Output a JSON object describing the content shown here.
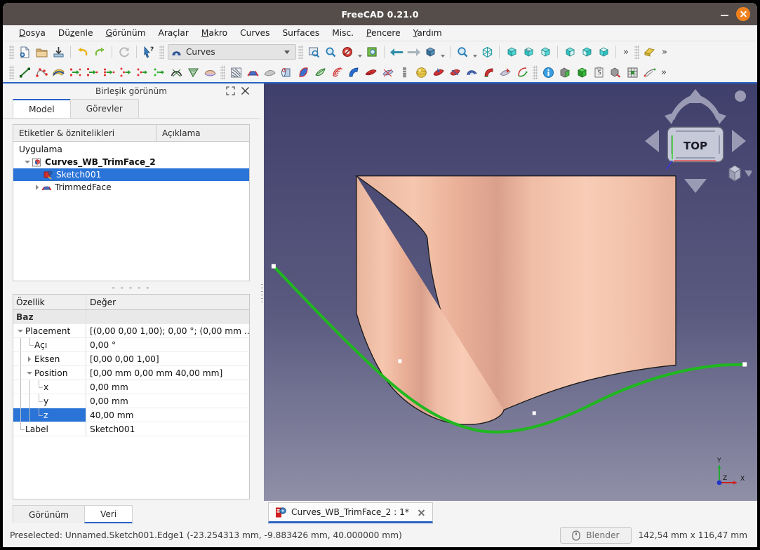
{
  "window": {
    "title": "FreeCAD 0.21.0",
    "minimize_label": "minimize-icon",
    "close_label": "close-icon",
    "accent_color": "#2a63c4",
    "close_button_color": "#f0821e",
    "titlebar_color": "#544d4a"
  },
  "menubar": {
    "items": [
      {
        "label": "Dosya",
        "accel": "D"
      },
      {
        "label": "Düzenle",
        "accel": "z"
      },
      {
        "label": "Görünüm",
        "accel": "G"
      },
      {
        "label": "Araçlar",
        "accel": ""
      },
      {
        "label": "Makro",
        "accel": "M"
      },
      {
        "label": "Curves",
        "accel": ""
      },
      {
        "label": "Surfaces",
        "accel": ""
      },
      {
        "label": "Misc.",
        "accel": ""
      },
      {
        "label": "Pencere",
        "accel": "P"
      },
      {
        "label": "Yardım",
        "accel": "Y"
      }
    ]
  },
  "toolbar": {
    "workbench_selected": "Curves",
    "overflow_label": "»",
    "row1_icons": [
      "new-document-icon",
      "open-document-icon",
      "save-document-icon",
      "undo-icon",
      "redo-icon",
      "refresh-icon",
      "whats-this-icon"
    ],
    "row1_view_icons": [
      "fit-all-icon",
      "fit-selection-icon",
      "draw-style-icon",
      "box-selection-icon",
      "back-arrow-icon",
      "forward-arrow-icon",
      "axonometric-view-icon",
      "zoom-icon",
      "isometric-view-icon",
      "front-view-icon",
      "top-view-icon",
      "right-view-icon",
      "rear-view-icon",
      "bottom-view-icon",
      "left-view-icon"
    ],
    "row2_icons": [
      "line-icon",
      "bezier-curve-icon",
      "gordon-surface-icon",
      "join-curve-icon",
      "discretize-icon",
      "approximate-icon",
      "interpolate-icon",
      "parametric-blend-icon",
      "curve-extend-icon",
      "curve-on-surface-icon",
      "sketch-on-surface-icon",
      "surface-patch-icon",
      "isocurve-icon",
      "blend-surface-icon",
      "flatten-face-icon",
      "pipeshell-icon",
      "sweep2rails-icon",
      "profile-support-icon",
      "segment-surface-icon",
      "ruled-surface-icon",
      "trim-face-icon",
      "surface-knots-icon",
      "compression-spring-icon",
      "sphere-icon",
      "zebra-stripes-icon",
      "solid-from-shell-icon",
      "face-map-icon",
      "pipe-icon",
      "paste-object-icon",
      "mixed-curve-icon",
      "info-icon",
      "extract-shape-icon",
      "solid-box-icon",
      "clipboard-icon",
      "shape-info-icon",
      "grid-icon",
      "nurbs-icon"
    ]
  },
  "left_panel": {
    "header_title": "Birleşik görünüm",
    "float_icon": "restore-icon",
    "close_icon": "close-icon",
    "tabs": [
      {
        "label": "Model",
        "active": true
      },
      {
        "label": "Görevler",
        "active": false
      }
    ],
    "tree": {
      "columns": [
        "Etiketler & öznitelikleri",
        "Açıklama"
      ],
      "root_label": "Uygulama",
      "nodes": [
        {
          "label": "Curves_WB_TrimFace_2",
          "icon": "document-icon",
          "depth": 1,
          "expander": "down",
          "bold": true,
          "selected": false
        },
        {
          "label": "Sketch001",
          "icon": "sketch-icon",
          "depth": 2,
          "expander": "none",
          "bold": false,
          "selected": true
        },
        {
          "label": "TrimmedFace",
          "icon": "trimmed-face-icon",
          "depth": 2,
          "expander": "right",
          "bold": false,
          "selected": false
        }
      ]
    },
    "separator": "- - - - -",
    "properties": {
      "columns": [
        "Özellik",
        "Değer"
      ],
      "group_label": "Baz",
      "rows": [
        {
          "name": "Placement",
          "value": "[(0,00 0,00 1,00); 0,00 °; (0,00 mm  ...",
          "depth": 0,
          "expander": "down",
          "selected": false
        },
        {
          "name": "Açı",
          "value": "0,00 °",
          "depth": 1,
          "expander": "none",
          "selected": false
        },
        {
          "name": "Eksen",
          "value": "[0,00 0,00 1,00]",
          "depth": 1,
          "expander": "right",
          "selected": false
        },
        {
          "name": "Position",
          "value": "[0,00 mm  0,00 mm  40,00 mm]",
          "depth": 1,
          "expander": "down",
          "selected": false
        },
        {
          "name": "x",
          "value": "0,00 mm",
          "depth": 2,
          "expander": "none",
          "selected": false
        },
        {
          "name": "y",
          "value": "0,00 mm",
          "depth": 2,
          "expander": "none",
          "selected": false
        },
        {
          "name": "z",
          "value": "40,00 mm",
          "depth": 2,
          "expander": "none",
          "selected": true
        },
        {
          "name": "Label",
          "value": "Sketch001",
          "depth": 0,
          "expander": "none",
          "selected": false
        }
      ]
    },
    "bottom_tabs": [
      {
        "label": "Görünüm",
        "active": false
      },
      {
        "label": "Veri",
        "active": true
      }
    ]
  },
  "viewport": {
    "nav_cube_face": "TOP",
    "nav_cube_icons": [
      "rotate-left-arc-icon",
      "rotate-right-arc-icon",
      "arrow-up-icon",
      "arrow-down-icon",
      "arrow-left-icon",
      "arrow-right-icon",
      "corner-dot-icon",
      "view-cube-menu-icon"
    ],
    "axis_labels": {
      "x": "X",
      "y": "Y",
      "z": "Z"
    },
    "axis_colors": {
      "x": "#cc2222",
      "y": "#22aa33",
      "z": "#2233cc"
    },
    "surface_color": "#f2bba4",
    "curve_color": "#1fb81f",
    "background_top": "#3f3f6b",
    "background_bottom": "#8f8fa6"
  },
  "document_tab": {
    "label": "Curves_WB_TrimFace_2 : 1*",
    "icon": "freecad-document-icon",
    "close_icon": "close-icon"
  },
  "statusbar": {
    "message": "Preselected: Unnamed.Sketch001.Edge1 (-23.254313 mm, -9.883426 mm, 40.000000 mm)",
    "navigation_button": "Blender",
    "navigation_icon": "mouse-icon",
    "dimensions": "142,54 mm x 116,47 mm"
  }
}
